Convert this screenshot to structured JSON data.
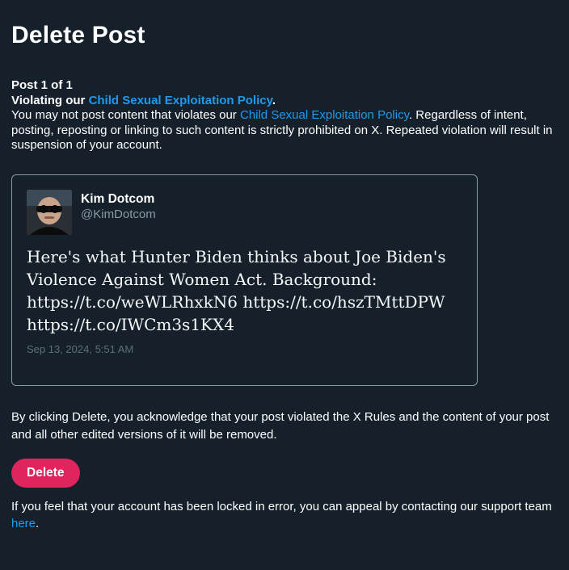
{
  "page": {
    "title": "Delete Post"
  },
  "notice": {
    "post_count": "Post 1 of 1",
    "violation_prefix": "Violating our ",
    "policy_link": "Child Sexual Exploitation Policy",
    "violation_suffix": ".",
    "desc_prefix": "You may not post content that violates our ",
    "desc_link": "Child Sexual Exploitation Policy",
    "desc_suffix": ". Regardless of intent, posting, reposting or linking to such content is strictly prohibited on X. Repeated violation will result in suspension of your account."
  },
  "post": {
    "author_name": "Kim Dotcom",
    "author_handle": "@KimDotcom",
    "avatar_icon": "user-avatar-photo",
    "text_lines": [
      "Here's what Hunter Biden thinks about Joe Biden's",
      "Violence Against Women Act. Background:",
      "https://t.co/weWLRhxkN6 https://t.co/hszTMttDPW",
      "https://t.co/IWCm3s1KX4"
    ],
    "timestamp": "Sep 13, 2024, 5:51 AM"
  },
  "acknowledgement": "By clicking Delete, you acknowledge that your post violated the X Rules and the content of your post and all other edited versions of it will be removed.",
  "actions": {
    "delete_label": "Delete"
  },
  "appeal": {
    "text_prefix": "If you feel that your account has been locked in error, you can appeal by contacting our support team ",
    "link_label": "here",
    "text_suffix": "."
  },
  "colors": {
    "background": "#15202b",
    "link": "#1d9bf0",
    "delete_button": "#e0245e",
    "muted_text": "#8b98a5"
  }
}
